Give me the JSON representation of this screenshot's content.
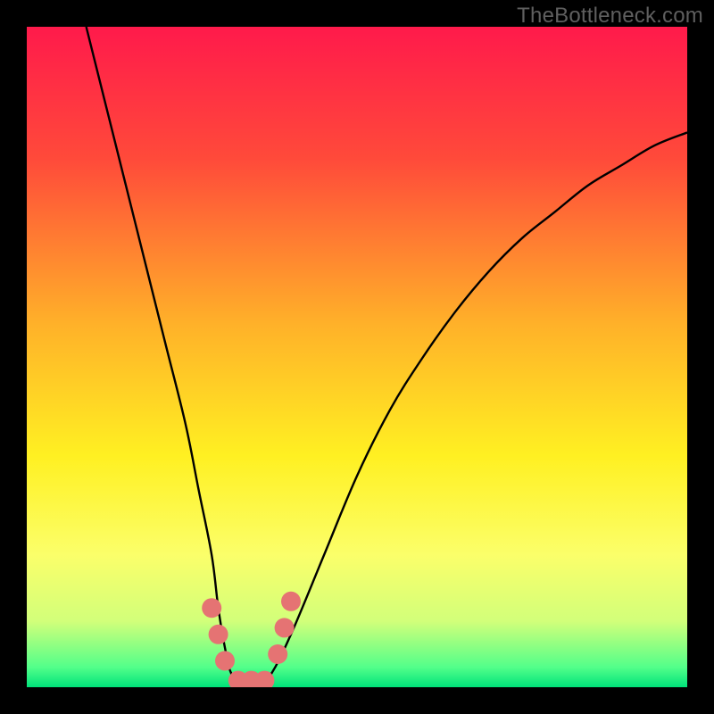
{
  "watermark": {
    "text": "TheBottleneck.com"
  },
  "chart_data": {
    "type": "line",
    "title": "",
    "xlabel": "",
    "ylabel": "",
    "xlim": [
      0,
      100
    ],
    "ylim": [
      0,
      100
    ],
    "grid": false,
    "legend": false,
    "background_gradient": {
      "stops": [
        {
          "pct": 0,
          "color": "#ff1a4b"
        },
        {
          "pct": 20,
          "color": "#ff4a3a"
        },
        {
          "pct": 45,
          "color": "#ffb129"
        },
        {
          "pct": 65,
          "color": "#fff022"
        },
        {
          "pct": 80,
          "color": "#fbff6a"
        },
        {
          "pct": 90,
          "color": "#d2ff7a"
        },
        {
          "pct": 97,
          "color": "#52ff8a"
        },
        {
          "pct": 100,
          "color": "#00e27a"
        }
      ]
    },
    "series": [
      {
        "name": "bottleneck-curve",
        "color": "#000000",
        "x": [
          9,
          12,
          15,
          18,
          21,
          24,
          26,
          28,
          29,
          30,
          31,
          33,
          35,
          37,
          40,
          45,
          50,
          55,
          60,
          65,
          70,
          75,
          80,
          85,
          90,
          95,
          100
        ],
        "y": [
          100,
          88,
          76,
          64,
          52,
          40,
          30,
          20,
          12,
          6,
          2,
          0,
          0,
          2,
          8,
          20,
          32,
          42,
          50,
          57,
          63,
          68,
          72,
          76,
          79,
          82,
          84
        ]
      }
    ],
    "markers": {
      "name": "bottom-hump-markers",
      "color": "#e57373",
      "points": [
        {
          "x": 28,
          "y": 12
        },
        {
          "x": 29,
          "y": 8
        },
        {
          "x": 30,
          "y": 4
        },
        {
          "x": 32,
          "y": 1
        },
        {
          "x": 34,
          "y": 1
        },
        {
          "x": 36,
          "y": 1
        },
        {
          "x": 38,
          "y": 5
        },
        {
          "x": 39,
          "y": 9
        },
        {
          "x": 40,
          "y": 13
        }
      ],
      "radius_px": 11
    }
  }
}
